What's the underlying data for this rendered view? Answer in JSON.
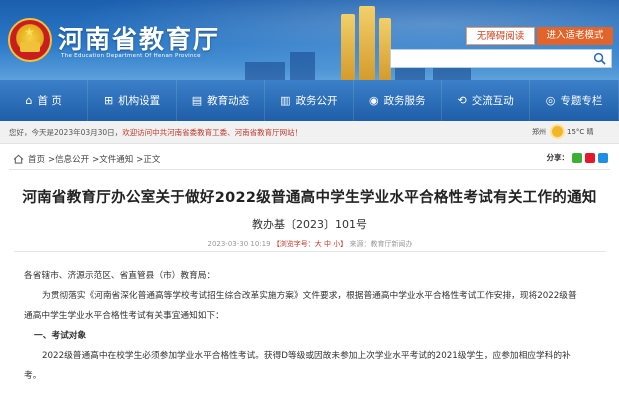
{
  "header": {
    "site_title": "河南省教育厅",
    "site_subtitle": "The Education Department Of Henan Province",
    "btn_accessibility": "无障碍阅读",
    "btn_elder_mode": "进入适老模式",
    "search_placeholder": ""
  },
  "nav": {
    "items": [
      {
        "icon": "home-icon",
        "label": "首 页"
      },
      {
        "icon": "org-icon",
        "label": "机构设置"
      },
      {
        "icon": "news-icon",
        "label": "教育动态"
      },
      {
        "icon": "doc-icon",
        "label": "政务公开"
      },
      {
        "icon": "service-icon",
        "label": "政务服务"
      },
      {
        "icon": "interact-icon",
        "label": "交流互动"
      },
      {
        "icon": "topic-icon",
        "label": "专题专栏"
      }
    ]
  },
  "welcome": {
    "text_before": "您好，今天是2023年03月30日，",
    "text_highlight": "欢迎访问中共河南省委教育工委、河南省教育厅网站！",
    "city": "郑州",
    "weather": "15°C 晴"
  },
  "breadcrumb": {
    "items": [
      "首页",
      ">信息公开",
      ">文件通知",
      ">正文"
    ],
    "share_label": "分享："
  },
  "article": {
    "title": "河南省教育厅办公室关于做好2022级普通高中学生学业水平合格性考试有关工作的通知",
    "doc_number": "教办基〔2023〕101号",
    "meta_date": "2023-03-30 10:19",
    "meta_size": "【浏览字号：大 中 小】",
    "meta_source": "来源：教育厅新闻办",
    "paragraphs": {
      "p1": "各省辖市、济源示范区、省直管县（市）教育局：",
      "p2": "为贯彻落实《河南省深化普通高等学校考试招生综合改革实施方案》文件要求，根据普通高中学业水平合格性考试工作安排，现将2022级普",
      "p3": "通高中学生学业水平合格性考试有关事宜通知如下：",
      "h1": "一、考试对象",
      "p4": "2022级普通高中在校学生必须参加学业水平合格性考试。获得D等级或因故未参加上次学业水平考试的2021级学生，应参加相应学科的补",
      "p5": "考。"
    }
  },
  "colors": {
    "nav_blue": "#1f5ea8",
    "accent_orange": "#e2642a",
    "highlight_red": "#c0392b"
  }
}
